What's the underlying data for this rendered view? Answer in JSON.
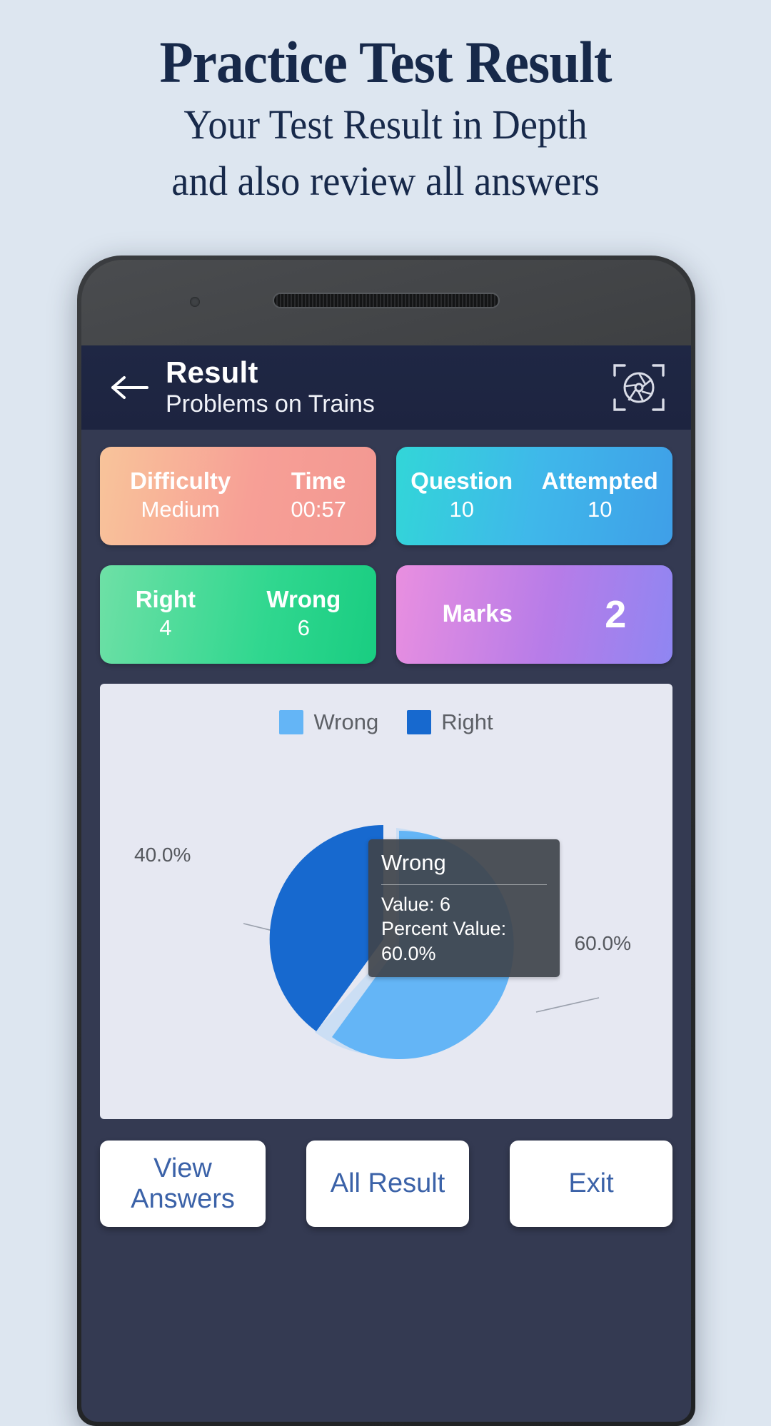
{
  "promo": {
    "title": "Practice Test Result",
    "subtitle_line1": "Your Test Result in Depth",
    "subtitle_line2": "and also review all answers"
  },
  "appbar": {
    "title": "Result",
    "subtitle": "Problems on Trains",
    "back_icon": "back-arrow-icon",
    "action_icon": "screenshot-aperture-icon"
  },
  "cards": [
    {
      "accent": "#f79f96",
      "cells": [
        {
          "label": "Difficulty",
          "value": "Medium"
        },
        {
          "label": "Time",
          "value": "00:57"
        }
      ]
    },
    {
      "accent": "#3fb8ea",
      "cells": [
        {
          "label": "Question",
          "value": "10"
        },
        {
          "label": "Attempted",
          "value": "10"
        }
      ]
    },
    {
      "accent": "#30d78f",
      "cells": [
        {
          "label": "Right",
          "value": "4"
        },
        {
          "label": "Wrong",
          "value": "6"
        }
      ]
    },
    {
      "accent": "#b77ce8",
      "cells": [
        {
          "label": "Marks",
          "value": "2"
        }
      ]
    }
  ],
  "chart_data": {
    "type": "pie",
    "title": "",
    "categories": [
      "Wrong",
      "Right"
    ],
    "values": [
      6,
      4
    ],
    "percent_labels": [
      "60.0%",
      "40.0%"
    ],
    "colors": [
      "#64b5f6",
      "#1769cf"
    ],
    "legend": [
      {
        "label": "Wrong",
        "color": "#64b5f6"
      },
      {
        "label": "Right",
        "color": "#1769cf"
      }
    ],
    "legend_position": "top",
    "exploded_slice": "Wrong",
    "background": "#e6e8f2",
    "tooltip": {
      "title": "Wrong",
      "value_line": "Value: 6",
      "percent_line": "Percent Value: 60.0%"
    }
  },
  "actions": [
    {
      "label": "View\nAnswers",
      "line1": "View",
      "line2": "Answers"
    },
    {
      "label": "All Result",
      "line1": "All Result",
      "line2": ""
    },
    {
      "label": "Exit",
      "line1": "Exit",
      "line2": ""
    }
  ],
  "colors": {
    "page_background": "#dde6f0",
    "promo_text": "#17294a",
    "screen_background": "#343a52",
    "appbar_background": "#1f2744",
    "button_text": "#3b62a8"
  }
}
